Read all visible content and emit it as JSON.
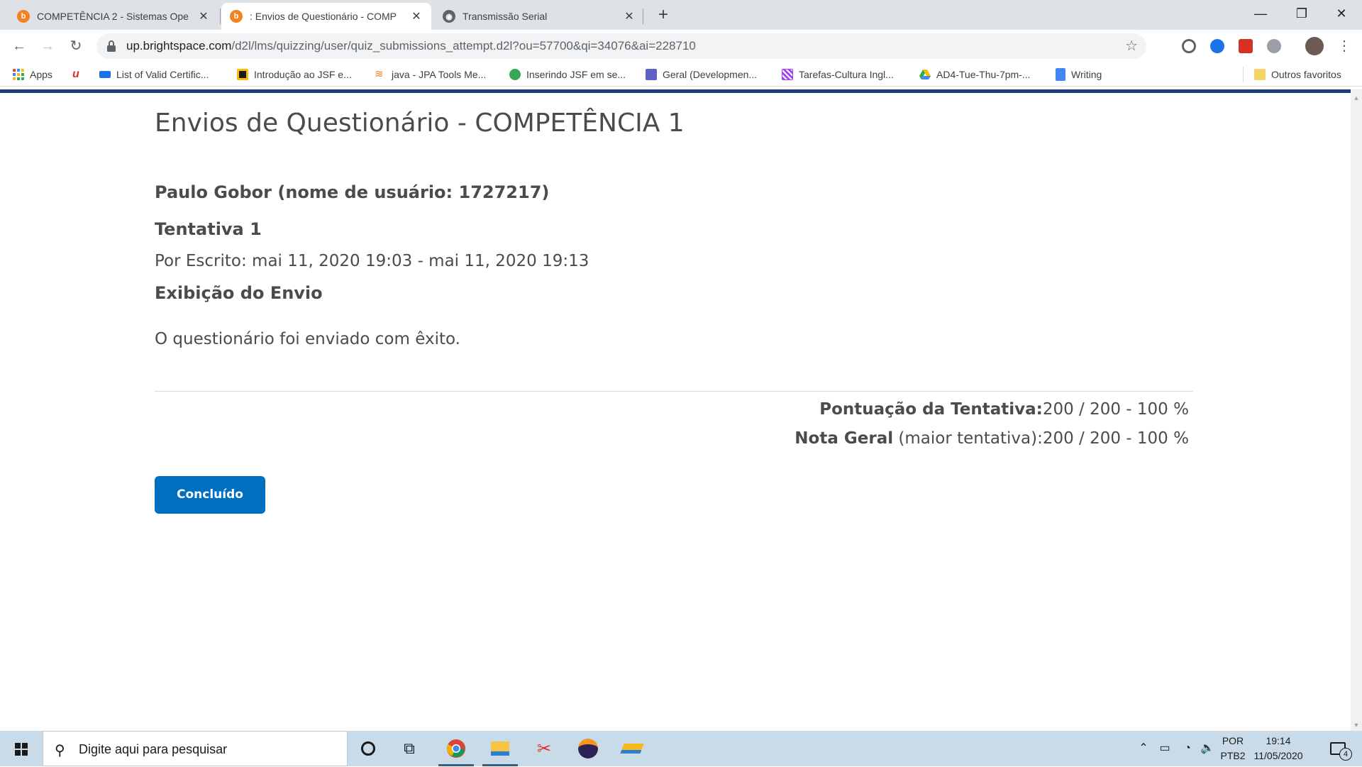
{
  "browser": {
    "tabs": [
      {
        "title": "COMPETÊNCIA 2 - Sistemas Ope",
        "favicon": "brightspace-icon",
        "active": false
      },
      {
        "title": ": Envios de Questionário - COMP",
        "favicon": "brightspace-icon",
        "active": true
      },
      {
        "title": "Transmissão Serial",
        "favicon": "globe-icon",
        "active": false
      }
    ],
    "new_tab": "+",
    "window": {
      "minimize": "—",
      "restore": "❐",
      "close": "✕"
    },
    "url_host": "up.brightspace.com",
    "url_path": "/d2l/lms/quizzing/user/quiz_submissions_attempt.d2l?ou=57700&qi=34076&ai=228710",
    "bookmarks": [
      {
        "label": "Apps",
        "icon": "apps-grid-icon"
      },
      {
        "label": "",
        "icon": "u-logo-icon"
      },
      {
        "label": "List of Valid Certific...",
        "icon": "sap-icon"
      },
      {
        "label": "Introdução ao JSF e...",
        "icon": "page-icon"
      },
      {
        "label": "java - JPA Tools Me...",
        "icon": "stackoverflow-icon"
      },
      {
        "label": "Inserindo JSF em se...",
        "icon": "green-circle-icon"
      },
      {
        "label": "Geral (Developmen...",
        "icon": "teams-icon"
      },
      {
        "label": "Tarefas-Cultura Ingl...",
        "icon": "purple-pattern-icon"
      },
      {
        "label": "AD4-Tue-Thu-7pm-...",
        "icon": "google-drive-icon"
      },
      {
        "label": "Writing",
        "icon": "google-docs-icon"
      }
    ],
    "other_bookmarks": "Outros favoritos"
  },
  "page": {
    "title": "Envios de Questionário - COMPETÊNCIA 1",
    "user_line": "Paulo Gobor (nome de usuário: 1727217)",
    "attempt": "Tentativa 1",
    "written": "Por Escrito: mai 11, 2020 19:03 - mai 11, 2020 19:13",
    "display_heading": "Exibição do Envio",
    "success_message": "O questionário foi enviado com êxito.",
    "attempt_score_label": "Pontuação da Tentativa:",
    "attempt_score_value": "200 / 200 - 100 %",
    "overall_label": "Nota Geral",
    "overall_sub": "(maior tentativa):",
    "overall_value": "200 / 200 - 100 %",
    "done_button": "Concluído"
  },
  "taskbar": {
    "search_placeholder": "Digite aqui para pesquisar",
    "lang_line1": "POR",
    "lang_line2": "PTB2",
    "time": "19:14",
    "date": "11/05/2020",
    "notifications": "4"
  },
  "colors": {
    "accent": "#006fbf",
    "header_bar": "#1d3b7a",
    "taskbar": "#c9dbe8"
  }
}
